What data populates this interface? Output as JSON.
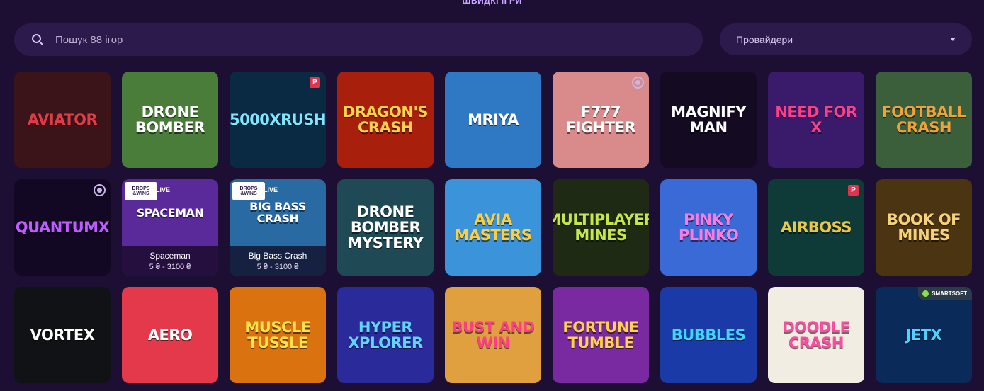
{
  "section_title": "ШВИДКІ ІГРИ",
  "search": {
    "placeholder": "Пошук 88 ігор",
    "icon": "search-icon"
  },
  "provider_filter": {
    "label": "Провайдери",
    "icon": "chevron-down-icon"
  },
  "games": [
    {
      "title": "Aviator",
      "bg": "#3a1418",
      "fg": "#e23b48",
      "badge": ""
    },
    {
      "title": "Drone Bomber",
      "bg": "#4a7d3a",
      "fg": "#ffffff",
      "badge": ""
    },
    {
      "title": "5000xRush",
      "bg": "#0a2a44",
      "fg": "#7fe6ff",
      "badge": "P"
    },
    {
      "title": "Dragon's Crash",
      "bg": "#a8200c",
      "fg": "#ffd34d",
      "badge": ""
    },
    {
      "title": "Mriya",
      "bg": "#2f78c4",
      "fg": "#ffffff",
      "badge": ""
    },
    {
      "title": "F777 Fighter",
      "bg": "#d98a8a",
      "fg": "#ffffff",
      "badge": "circle"
    },
    {
      "title": "Magnify Man",
      "bg": "#140a22",
      "fg": "#ffffff",
      "badge": ""
    },
    {
      "title": "Need for X",
      "bg": "#3a1a6a",
      "fg": "#ff3e8a",
      "badge": ""
    },
    {
      "title": "Football Crash",
      "bg": "#3b5f3a",
      "fg": "#f0a23a",
      "badge": ""
    },
    {
      "title": "QuantumX",
      "bg": "#120824",
      "fg": "#c05cff",
      "badge": "circle"
    },
    {
      "title": "Spaceman",
      "bg": "#5a2a9a",
      "fg": "#ffffff",
      "badge": "drops",
      "live": "LIVE",
      "name": "Spaceman",
      "range": "5 ₴ - 3100 ₴"
    },
    {
      "title": "Big Bass Crash",
      "bg": "#2a6aa2",
      "fg": "#ffffff",
      "badge": "drops",
      "live": "LIVE",
      "name": "Big Bass Crash",
      "range": "5 ₴ - 3100 ₴"
    },
    {
      "title": "Drone Bomber Mystery",
      "bg": "#1f4a55",
      "fg": "#ffffff",
      "badge": ""
    },
    {
      "title": "Avia Masters",
      "bg": "#3b93d9",
      "fg": "#ffce3a",
      "badge": ""
    },
    {
      "title": "Multiplayer Mines",
      "bg": "#1e2a14",
      "fg": "#c6e64a",
      "badge": ""
    },
    {
      "title": "Pinky Plinko",
      "bg": "#3a6ad6",
      "fg": "#ff7adf",
      "badge": ""
    },
    {
      "title": "AirBoss",
      "bg": "#0e3a38",
      "fg": "#e8c84a",
      "badge": "P"
    },
    {
      "title": "Book of Mines",
      "bg": "#4a3412",
      "fg": "#f5d27a",
      "badge": ""
    },
    {
      "title": "Vortex",
      "bg": "#111216",
      "fg": "#ffffff",
      "badge": ""
    },
    {
      "title": "Aero",
      "bg": "#e3394a",
      "fg": "#ffffff",
      "badge": ""
    },
    {
      "title": "Muscle Tussle",
      "bg": "#d9720f",
      "fg": "#ffe24a",
      "badge": ""
    },
    {
      "title": "Hyper Xplorer",
      "bg": "#2a2a9a",
      "fg": "#5fd4ff",
      "badge": ""
    },
    {
      "title": "Bust and Win",
      "bg": "#e0a040",
      "fg": "#ff3e8a",
      "badge": ""
    },
    {
      "title": "Fortune Tumble",
      "bg": "#7a2aa0",
      "fg": "#ffd24a",
      "badge": ""
    },
    {
      "title": "Bubbles",
      "bg": "#1a3aa8",
      "fg": "#3fd7ff",
      "badge": ""
    },
    {
      "title": "Doodle Crash",
      "bg": "#f2ede2",
      "fg": "#ff4aa2",
      "badge": ""
    },
    {
      "title": "JetX",
      "bg": "#0a2a5a",
      "fg": "#4fd2ff",
      "badge": "smartsoft",
      "badge_text": "SMARTSOFT"
    }
  ]
}
